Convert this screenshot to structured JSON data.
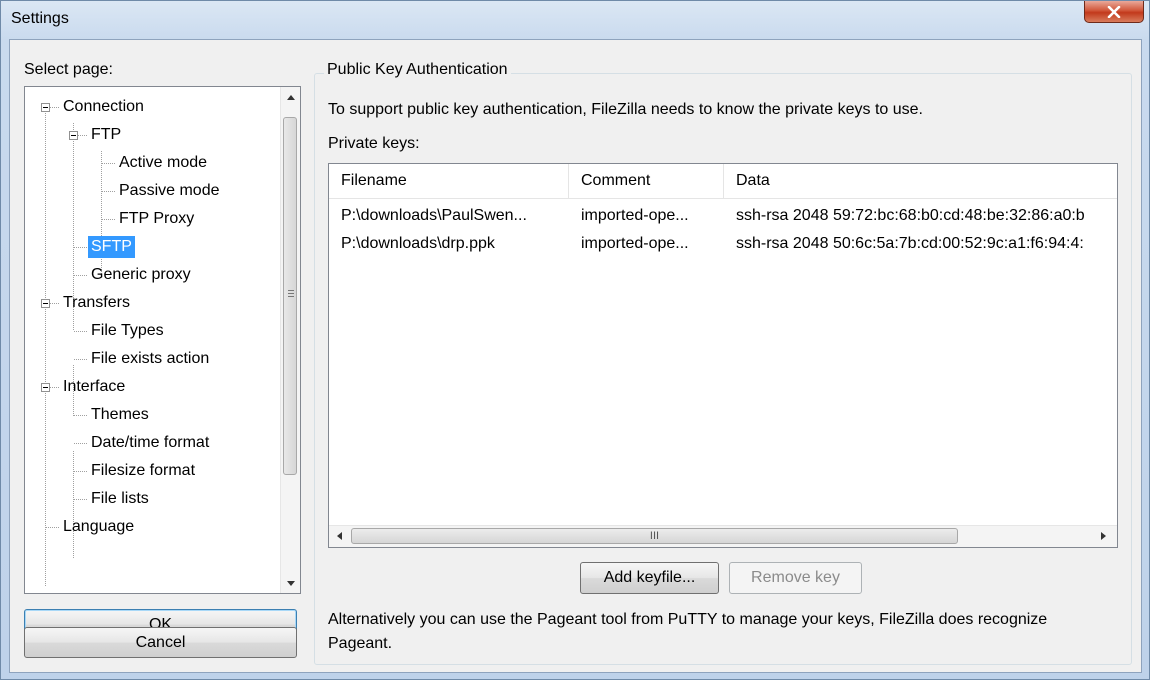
{
  "window": {
    "title": "Settings"
  },
  "left": {
    "select_label": "Select page:",
    "tree": [
      {
        "label": "Connection"
      },
      {
        "label": "FTP"
      },
      {
        "label": "Active mode"
      },
      {
        "label": "Passive mode"
      },
      {
        "label": "FTP Proxy"
      },
      {
        "label": "SFTP",
        "selected": true
      },
      {
        "label": "Generic proxy"
      },
      {
        "label": "Transfers"
      },
      {
        "label": "File Types"
      },
      {
        "label": "File exists action"
      },
      {
        "label": "Interface"
      },
      {
        "label": "Themes"
      },
      {
        "label": "Date/time format"
      },
      {
        "label": "Filesize format"
      },
      {
        "label": "File lists"
      },
      {
        "label": "Language"
      }
    ],
    "ok_label": "OK",
    "cancel_label": "Cancel"
  },
  "panel": {
    "group_title": "Public Key Authentication",
    "description": "To support public key authentication, FileZilla needs to know the private keys to use.",
    "private_keys_label": "Private keys:",
    "columns": [
      "Filename",
      "Comment",
      "Data"
    ],
    "rows": [
      {
        "filename": "P:\\downloads\\PaulSwen...",
        "comment": "imported-ope...",
        "data": "ssh-rsa 2048 59:72:bc:68:b0:cd:48:be:32:86:a0:b"
      },
      {
        "filename": "P:\\downloads\\drp.ppk",
        "comment": "imported-ope...",
        "data": "ssh-rsa 2048 50:6c:5a:7b:cd:00:52:9c:a1:f6:94:4:"
      }
    ],
    "hscroll_grip": "III",
    "add_keyfile_label": "Add keyfile...",
    "remove_key_label": "Remove key",
    "alternative_text": "Alternatively you can use the Pageant tool from PuTTY to manage your keys, FileZilla does recognize Pageant."
  },
  "colors": {
    "selection": "#3399ff",
    "close_button": "#c2391c"
  },
  "icons": {
    "close": "close-icon",
    "tree_expander": "minus-box-icon"
  }
}
